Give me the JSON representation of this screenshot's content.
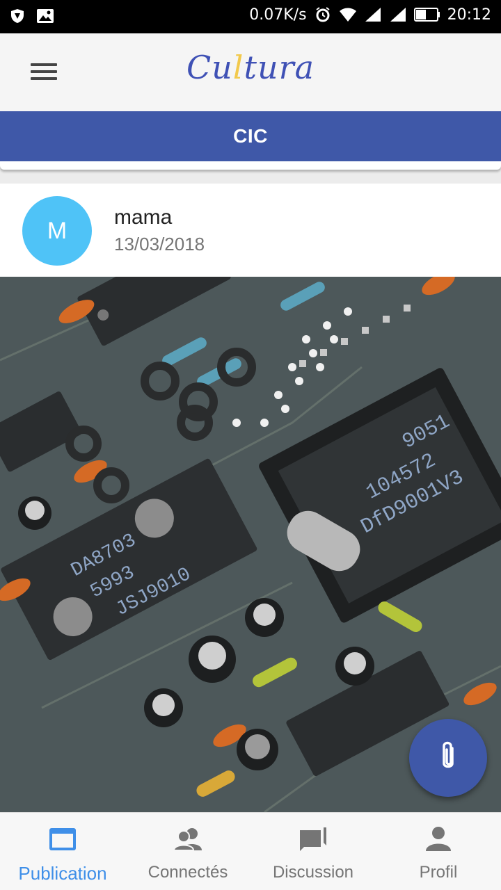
{
  "status_bar": {
    "network_speed": "0.07K/s",
    "time": "20:12",
    "left_icons": [
      "shield-app-icon",
      "image-icon"
    ],
    "right_icons": [
      "alarm-icon",
      "wifi-icon",
      "signal-icon",
      "signal-icon",
      "battery-icon"
    ]
  },
  "app_bar": {
    "logo": {
      "part1": "Cu",
      "accent": "l",
      "part2": "tura"
    },
    "menu_icon": "hamburger-menu-icon"
  },
  "section": {
    "title": "CIC"
  },
  "post": {
    "avatar_letter": "M",
    "author": "mama",
    "date": "13/03/2018",
    "image_subject": "circuit board"
  },
  "fab": {
    "icon": "attachment-icon"
  },
  "bottom_nav": {
    "items": [
      {
        "label": "Publication",
        "icon": "publication-icon",
        "active": true
      },
      {
        "label": "Connectés",
        "icon": "people-icon",
        "active": false
      },
      {
        "label": "Discussion",
        "icon": "chat-icon",
        "active": false
      },
      {
        "label": "Profil",
        "icon": "person-icon",
        "active": false
      }
    ]
  },
  "colors": {
    "primary": "#3f58a8",
    "active_nav": "#3f8fe8",
    "avatar": "#4fc3f7",
    "logo_accent": "#f2c94c"
  }
}
